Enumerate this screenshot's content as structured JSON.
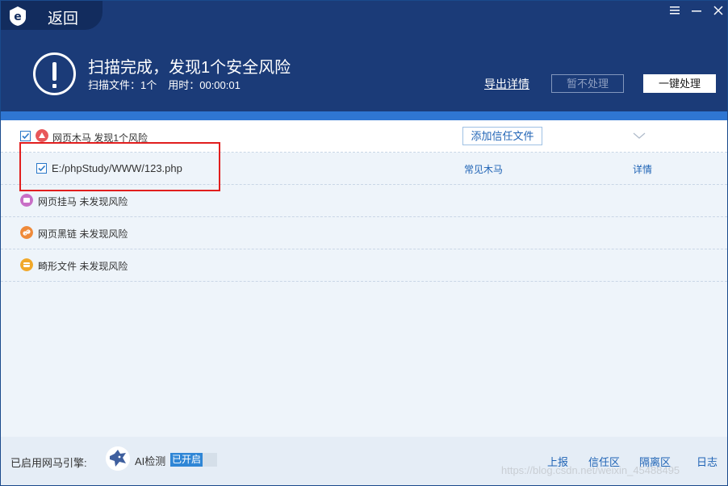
{
  "header": {
    "back_label": "返回",
    "title": "扫描完成，发现1个安全风险",
    "scanned_files": "扫描文件：1个",
    "elapsed": "用时：00:00:01",
    "export_link": "导出详情",
    "ignore_button": "暂不处理",
    "fix_button": "一键处理"
  },
  "results": {
    "main_category": "网页木马 发现1个风险",
    "add_trust_button": "添加信任文件",
    "file": {
      "path": "E:/phpStudy/WWW/123.php",
      "type": "常见木马",
      "detail_link": "详情"
    },
    "categories": [
      {
        "label": "网页挂马 未发现风险",
        "icon": "trojan-hang-icon",
        "color": "#c86fc6"
      },
      {
        "label": "网页黑链 未发现风险",
        "icon": "black-link-icon",
        "color": "#ef8a3a"
      },
      {
        "label": "畸形文件 未发现风险",
        "icon": "malformed-file-icon",
        "color": "#f1a82a"
      }
    ]
  },
  "footer": {
    "engine_label": "已启用网马引擎:",
    "ai_label": "AI检测",
    "ai_status": "已开启",
    "links": [
      "上报",
      "信任区",
      "隔离区",
      "日志"
    ],
    "watermark": "https://blog.csdn.net/weixin_45488495"
  },
  "colors": {
    "header_bg": "#1b3b78",
    "accent_blue": "#2f76d2",
    "link_blue": "#1f63b5",
    "highlight_red": "#e11e1e"
  }
}
